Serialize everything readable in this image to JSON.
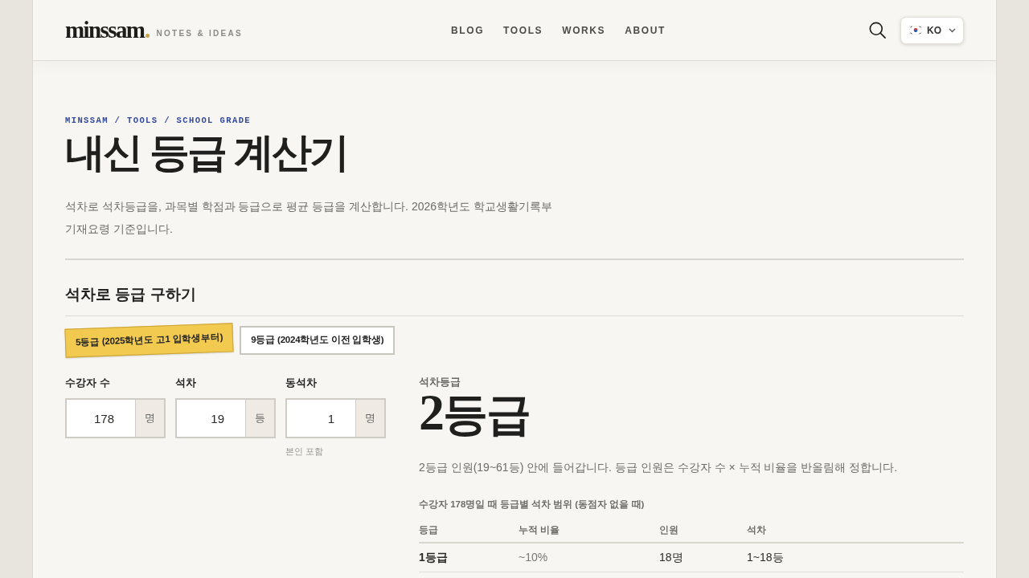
{
  "header": {
    "logo": "minssam",
    "tagline": "NOTES & IDEAS",
    "nav": [
      "BLOG",
      "TOOLS",
      "WORKS",
      "ABOUT"
    ],
    "language": {
      "code": "KO"
    }
  },
  "breadcrumb": "MINSSAM / TOOLS / SCHOOL GRADE",
  "title": "내신 등급 계산기",
  "description": "석차로 석차등급을, 과목별 학점과 등급으로 평균 등급을 계산합니다. 2026학년도 학교생활기록부 기재요령 기준입니다.",
  "section": {
    "title": "석차로 등급 구하기",
    "grade_systems": [
      {
        "label": "5등급 (2025학년도 고1 입학생부터)",
        "selected": true
      },
      {
        "label": "9등급 (2024학년도 이전 입학생)",
        "selected": false
      }
    ],
    "fields": [
      {
        "label": "수강자 수",
        "value": "178",
        "unit": "명"
      },
      {
        "label": "석차",
        "value": "19",
        "unit": "등"
      },
      {
        "label": "동석차",
        "value": "1",
        "unit": "명",
        "help": "본인 포함"
      }
    ],
    "result": {
      "label": "석차등급",
      "grade_number": "2",
      "grade_unit": "등급",
      "explanation": "2등급 인원(19~61등) 안에 들어갑니다. 등급 인원은 수강자 수 × 누적 비율을 반올림해 정합니다."
    },
    "table": {
      "caption": "수강자 178명일 때 등급별 석차 범위 (동점자 없을 때)",
      "columns": [
        "등급",
        "누적 비율",
        "인원",
        "석차"
      ],
      "rows": [
        [
          "1등급",
          "~10%",
          "18명",
          "1~18등"
        ]
      ]
    }
  }
}
